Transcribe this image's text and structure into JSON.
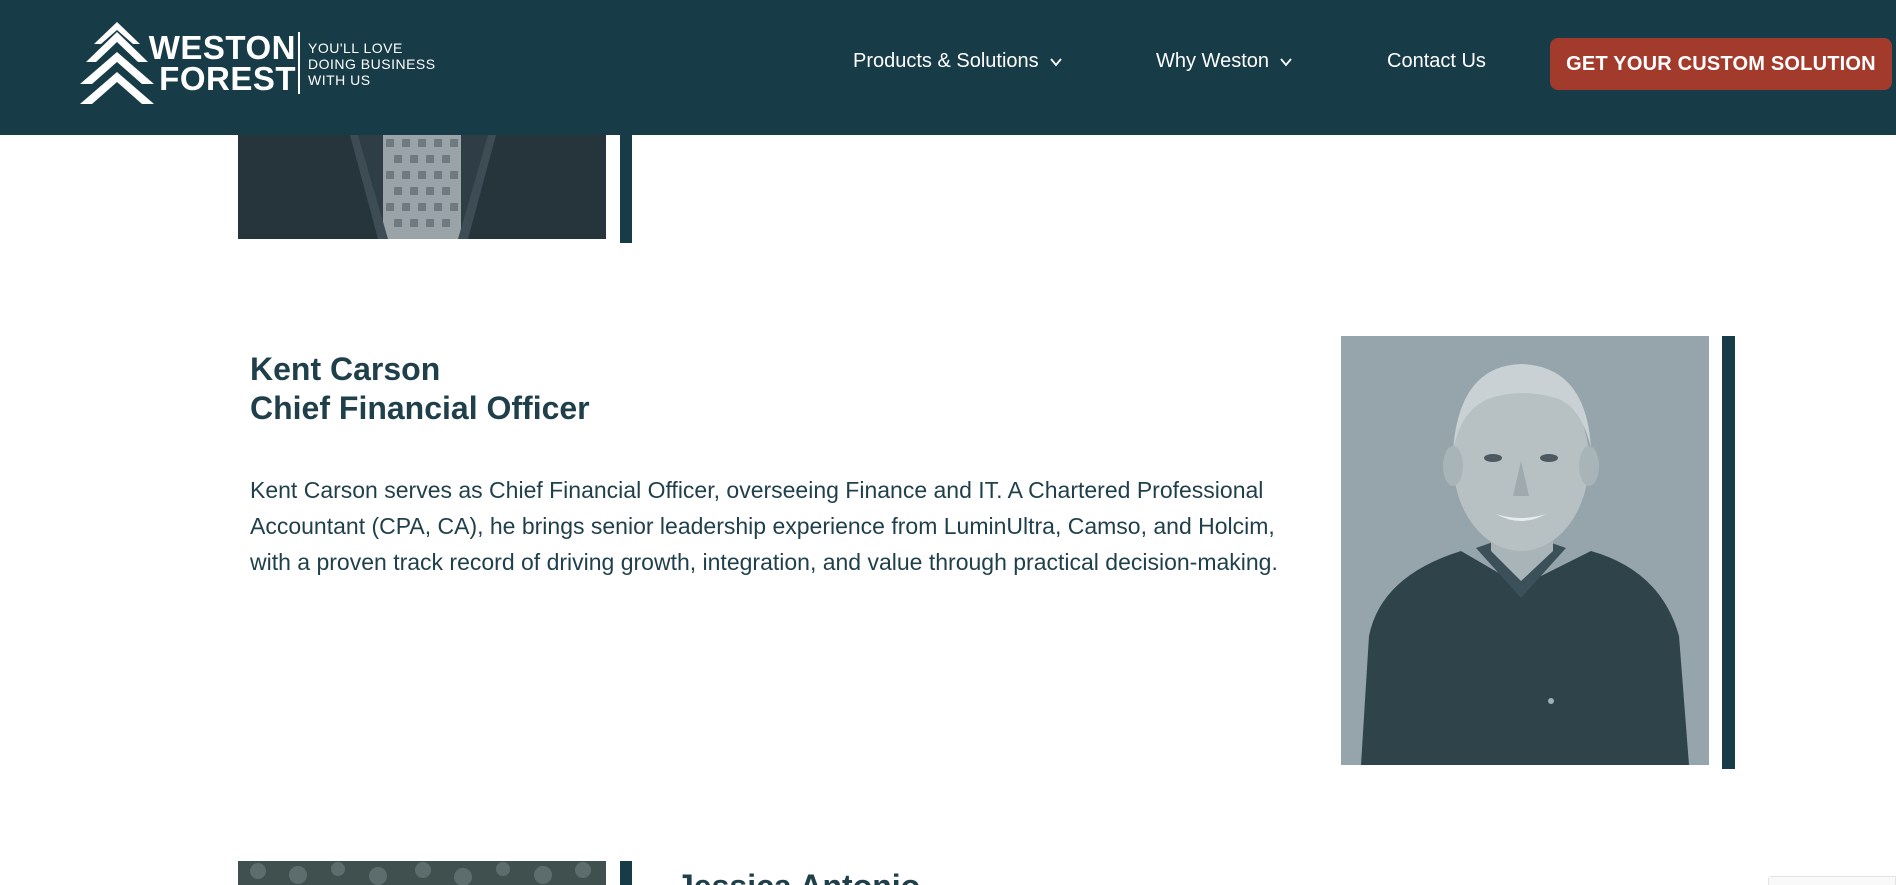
{
  "brand": {
    "name_line1": "WESTON",
    "name_line2": "FOREST",
    "tagline_line1": "YOU'LL LOVE",
    "tagline_line2": "DOING BUSINESS",
    "tagline_line3": "WITH US"
  },
  "nav": {
    "items": [
      {
        "label": "Products & Solutions",
        "has_dropdown": true
      },
      {
        "label": "Why Weston",
        "has_dropdown": true
      },
      {
        "label": "Contact Us",
        "has_dropdown": false
      }
    ],
    "cta_label": "GET YOUR CUSTOM SOLUTION"
  },
  "profile": {
    "name": "Kent Carson",
    "title": "Chief Financial Officer",
    "bio": "Kent Carson serves as Chief Financial Officer, overseeing Finance and IT. A Chartered Professional Accountant (CPA, CA), he brings senior leadership experience from LuminUltra, Camso, and Holcim, with a proven track record of driving growth, integration, and value through practical decision-making."
  },
  "next_profile": {
    "name_partial": "Jessica Antonio"
  },
  "colors": {
    "header_bg": "#173b47",
    "cta_bg": "#a23b2c",
    "accent": "#173b47",
    "text": "#1f3f4b"
  },
  "icons": {
    "dropdown": "chevron-down-icon",
    "logo": "weston-forest-chevron-logo"
  }
}
